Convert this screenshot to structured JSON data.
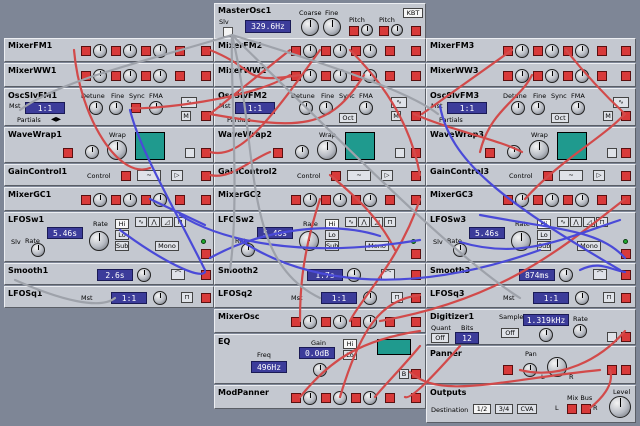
{
  "colors": {
    "panel": "#c4c8d0",
    "background": "#7e8696",
    "jack_red": "#d83a3a",
    "display": "#3c3c9a",
    "scope": "#1f9a8e",
    "cable_red": "#d24a4a",
    "cable_blue": "#4a4ad8"
  },
  "master": {
    "title": "MasterOsc1",
    "slv": "Slv",
    "freq": "329.6Hz",
    "coarse": "Coarse",
    "fine": "Fine",
    "pitch1": "Pitch",
    "pitch2": "Pitch",
    "kbt": "KBT"
  },
  "col1": {
    "mixerfm": "MixerFM1",
    "mixerww": "MixerWW1",
    "oscslvfm": "OscSlvFM1",
    "mst": "Mst",
    "ratio": "1:1",
    "detune": "Detune",
    "fine": "Fine",
    "sync": "Sync",
    "fma": "FMA",
    "partials": "Partials",
    "m": "M",
    "wavewrap": "WaveWrap1",
    "wrap": "Wrap",
    "gaincontrol": "GainControl1",
    "control": "Control",
    "mixergc": "MixerGC1",
    "lfosw": "LFOSw1",
    "rate": "Rate",
    "rate_val": "5.46s",
    "hi": "Hi",
    "lo": "Lo",
    "sub": "Sub",
    "mono": "Mono",
    "slv": "Slv",
    "smooth": "Smooth1",
    "smooth_val": "2.6s",
    "lfosq": "LFOSq1",
    "lfosq_mst": "Mst",
    "lfosq_ratio": "1:1"
  },
  "col2": {
    "mixerfm": "MixerFM2",
    "mixerww": "MixerWW2",
    "oscslvfm": "OscSlvFM2",
    "mst": "Mst",
    "ratio": "1:1",
    "detune": "Detune",
    "fine": "Fine",
    "sync": "Sync",
    "fma": "FMA",
    "partials": "Partials",
    "oct": "Oct",
    "m": "M",
    "wavewrap": "WaveWrap2",
    "wrap": "Wrap",
    "gaincontrol": "GainControl2",
    "control": "Control",
    "mixergc": "MixerGC2",
    "lfosw": "LFOSw2",
    "rate": "Rate",
    "rate_val": "5.46s",
    "hi": "Hi",
    "lo": "Lo",
    "sub": "Sub",
    "mono": "Mono",
    "smooth": "Smooth2",
    "smooth_val": "1.7s",
    "lfosq": "LFOSq2",
    "lfosq_mst": "Mst",
    "lfosq_ratio": "1:1",
    "mixerosc": "MixerOsc",
    "eq": "EQ",
    "freq": "Freq",
    "freq_val": "496Hz",
    "gain": "Gain",
    "gain_val": "0.0dB",
    "eq_hi": "Hi",
    "eq_lo": "Lo",
    "b": "B",
    "modpanner": "ModPanner"
  },
  "col3": {
    "mixerfm": "MixerFM3",
    "mixerww": "MixerWW3",
    "oscslvfm": "OscSlvFM3",
    "mst": "Mst",
    "ratio": "1:1",
    "detune": "Detune",
    "fine": "Fine",
    "sync": "Sync",
    "fma": "FMA",
    "partials": "Partials",
    "oct": "Oct",
    "m": "M",
    "wavewrap": "WaveWrap3",
    "wrap": "Wrap",
    "gaincontrol": "GainControl3",
    "control": "Control",
    "mixergc": "MixerGC3",
    "lfosw": "LFOSw3",
    "rate": "Rate",
    "rate_val": "5.46s",
    "hi": "Hi",
    "lo": "Lo",
    "sub": "Sub",
    "mono": "Mono",
    "slv": "Slv",
    "smooth": "Smooth3",
    "smooth_val": "874ms",
    "lfosq": "LFOSq3",
    "lfosq_mst": "Mst",
    "lfosq_ratio": "1:1"
  },
  "digitizer": {
    "title": "Digitizer1",
    "quant": "Quant",
    "bits": "Bits",
    "off": "Off",
    "bits_val": "12",
    "sample": "Sample",
    "sample_val": "1.319kHz",
    "sample_off": "Off",
    "rate": "Rate"
  },
  "panner": {
    "title": "Panner",
    "pan": "Pan",
    "l": "L",
    "r": "R"
  },
  "outputs": {
    "title": "Outputs",
    "destination": "Destination",
    "d12": "1/2",
    "d34": "3/4",
    "cva": "CVA",
    "mixbus": "Mix Bus",
    "level": "Level",
    "l": "L",
    "r": "R"
  }
}
